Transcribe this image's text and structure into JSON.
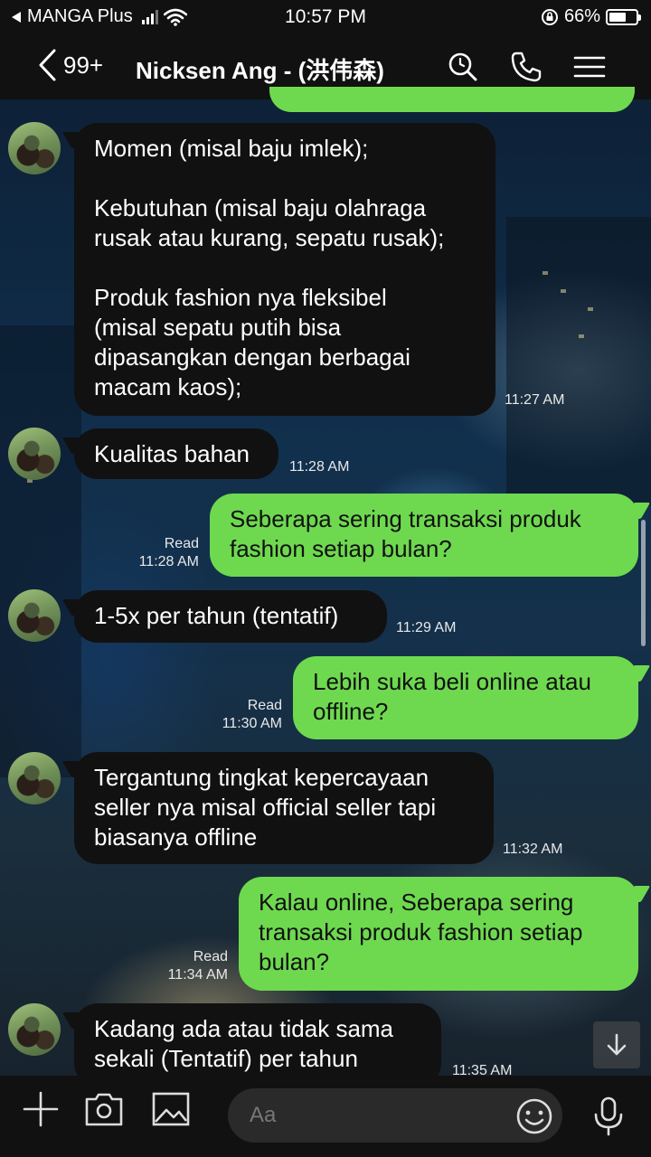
{
  "status_bar": {
    "back_app": "MANGA Plus",
    "time": "10:57 PM",
    "battery": "66%",
    "battery_level": 0.66
  },
  "header": {
    "unread_count": "99+",
    "title": "Nicksen Ang - (洪伟森)"
  },
  "messages": [
    {
      "dir": "in",
      "text": "Momen (misal baju imlek);\n\nKebutuhan (misal baju olahraga\nrusak atau kurang, sepatu rusak);\n\nProduk fashion nya fleksibel\n(misal sepatu putih bisa\ndipasangkan dengan berbagai\nmacam kaos);",
      "time": "11:27 AM"
    },
    {
      "dir": "in",
      "text": "Kualitas bahan",
      "time": "11:28 AM"
    },
    {
      "dir": "out",
      "text": "Seberapa sering transaksi produk\nfashion setiap bulan?",
      "read": "Read",
      "time": "11:28 AM"
    },
    {
      "dir": "in",
      "text": "1-5x per tahun (tentatif)",
      "time": "11:29 AM"
    },
    {
      "dir": "out",
      "text": "Lebih suka beli online atau\noffline?",
      "read": "Read",
      "time": "11:30 AM"
    },
    {
      "dir": "in",
      "text": "Tergantung tingkat kepercayaan\nseller nya misal official seller tapi\nbiasanya offline",
      "time": "11:32 AM"
    },
    {
      "dir": "out",
      "text": "Kalau online, Seberapa sering\ntransaksi produk fashion setiap\nbulan?",
      "read": "Read",
      "time": "11:34 AM"
    },
    {
      "dir": "in",
      "text": "Kadang ada atau tidak sama\nsekali (Tentatif) per tahun",
      "time": "11:35 AM"
    }
  ],
  "composer": {
    "placeholder": "Aa"
  },
  "icons": {
    "search": "search-icon",
    "call": "phone-icon",
    "menu": "menu-icon",
    "add": "plus-icon",
    "camera": "camera-icon",
    "gallery": "image-icon",
    "emoji": "emoji-icon",
    "mic": "microphone-icon",
    "scroll_down": "arrow-down-icon"
  },
  "colors": {
    "outgoing_bubble": "#6ed94f",
    "incoming_bubble": "#111111",
    "bar_background": "#111111"
  }
}
